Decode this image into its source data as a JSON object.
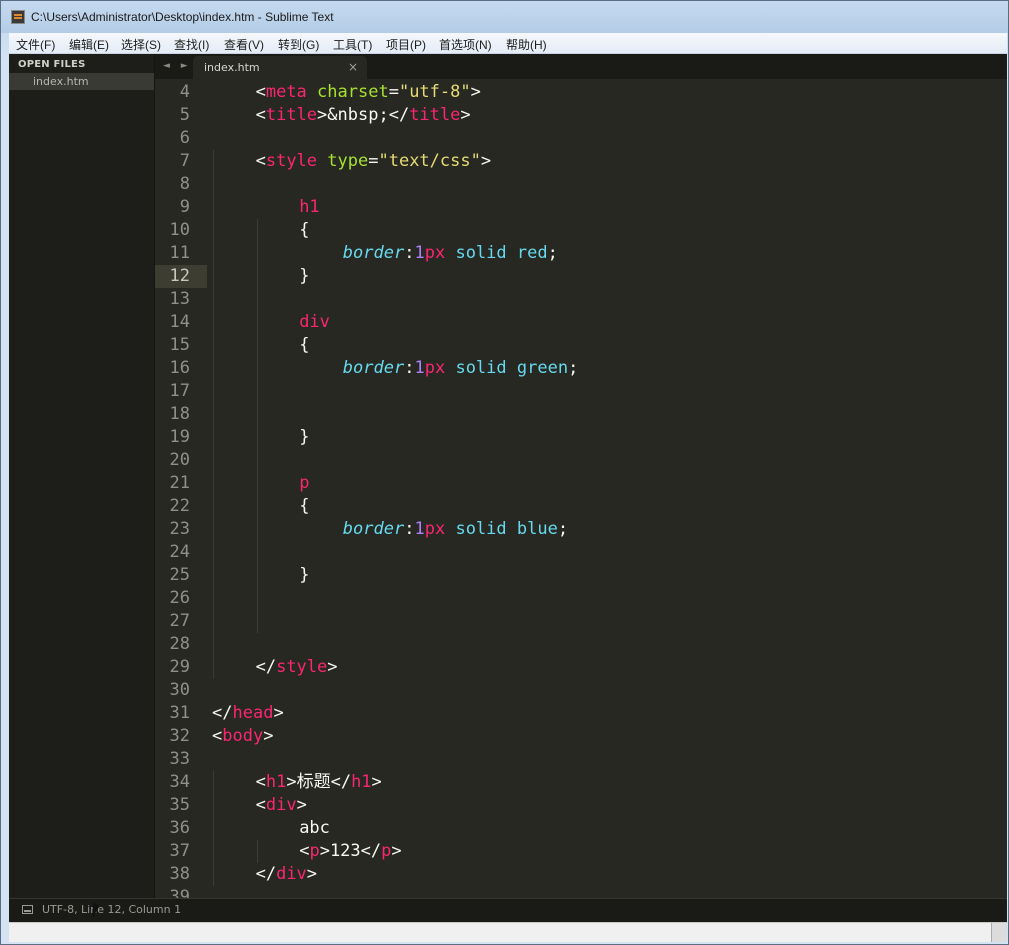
{
  "window": {
    "title": "C:\\Users\\Administrator\\Desktop\\index.htm - Sublime Text"
  },
  "menu": [
    "文件(F)",
    "编辑(E)",
    "选择(S)",
    "查找(I)",
    "查看(V)",
    "转到(G)",
    "工具(T)",
    "项目(P)",
    "首选项(N)",
    "帮助(H)"
  ],
  "sidebar": {
    "header": "OPEN FILES",
    "files": [
      "index.htm"
    ]
  },
  "tabs": {
    "nav": "◄ ►",
    "active": {
      "label": "index.htm",
      "close": "×"
    }
  },
  "editor": {
    "current_line": 12,
    "lines": [
      {
        "n": "4",
        "indent": 1,
        "tokens": [
          [
            "plain",
            "<"
          ],
          [
            "tag",
            "meta"
          ],
          [
            "plain",
            " "
          ],
          [
            "attr",
            "charset"
          ],
          [
            "plain",
            "="
          ],
          [
            "str",
            "\"utf-8\""
          ],
          [
            "plain",
            ">"
          ]
        ]
      },
      {
        "n": "5",
        "indent": 1,
        "tokens": [
          [
            "plain",
            "<"
          ],
          [
            "tag",
            "title"
          ],
          [
            "plain",
            ">"
          ],
          [
            "plain",
            "&nbsp;"
          ],
          [
            "plain",
            "</"
          ],
          [
            "tag",
            "title"
          ],
          [
            "plain",
            ">"
          ]
        ]
      },
      {
        "n": "6",
        "indent": 0,
        "tokens": []
      },
      {
        "n": "7",
        "indent": 1,
        "tokens": [
          [
            "plain",
            "<"
          ],
          [
            "tag",
            "style"
          ],
          [
            "plain",
            " "
          ],
          [
            "attr",
            "type"
          ],
          [
            "plain",
            "="
          ],
          [
            "str",
            "\"text/css\""
          ],
          [
            "plain",
            ">"
          ]
        ]
      },
      {
        "n": "8",
        "indent": 0,
        "tokens": []
      },
      {
        "n": "9",
        "indent": 2,
        "tokens": [
          [
            "tag",
            "h1"
          ]
        ]
      },
      {
        "n": "10",
        "indent": 2,
        "tokens": [
          [
            "plain",
            "{"
          ]
        ]
      },
      {
        "n": "11",
        "indent": 3,
        "tokens": [
          [
            "prop",
            "border"
          ],
          [
            "plain",
            ":"
          ],
          [
            "num",
            "1"
          ],
          [
            "unit",
            "px"
          ],
          [
            "plain",
            " "
          ],
          [
            "val",
            "solid"
          ],
          [
            "plain",
            " "
          ],
          [
            "val",
            "red"
          ],
          [
            "plain",
            ";"
          ]
        ]
      },
      {
        "n": "12",
        "indent": 2,
        "tokens": [
          [
            "plain",
            "}"
          ]
        ]
      },
      {
        "n": "13",
        "indent": 0,
        "tokens": []
      },
      {
        "n": "14",
        "indent": 2,
        "tokens": [
          [
            "tag",
            "div"
          ]
        ]
      },
      {
        "n": "15",
        "indent": 2,
        "tokens": [
          [
            "plain",
            "{"
          ]
        ]
      },
      {
        "n": "16",
        "indent": 3,
        "tokens": [
          [
            "prop",
            "border"
          ],
          [
            "plain",
            ":"
          ],
          [
            "num",
            "1"
          ],
          [
            "unit",
            "px"
          ],
          [
            "plain",
            " "
          ],
          [
            "val",
            "solid"
          ],
          [
            "plain",
            " "
          ],
          [
            "val",
            "green"
          ],
          [
            "plain",
            ";"
          ]
        ]
      },
      {
        "n": "17",
        "indent": 0,
        "tokens": []
      },
      {
        "n": "18",
        "indent": 0,
        "tokens": []
      },
      {
        "n": "19",
        "indent": 2,
        "tokens": [
          [
            "plain",
            "}"
          ]
        ]
      },
      {
        "n": "20",
        "indent": 0,
        "tokens": []
      },
      {
        "n": "21",
        "indent": 2,
        "tokens": [
          [
            "tag",
            "p"
          ]
        ]
      },
      {
        "n": "22",
        "indent": 2,
        "tokens": [
          [
            "plain",
            "{"
          ]
        ]
      },
      {
        "n": "23",
        "indent": 3,
        "tokens": [
          [
            "prop",
            "border"
          ],
          [
            "plain",
            ":"
          ],
          [
            "num",
            "1"
          ],
          [
            "unit",
            "px"
          ],
          [
            "plain",
            " "
          ],
          [
            "val",
            "solid"
          ],
          [
            "plain",
            " "
          ],
          [
            "val",
            "blue"
          ],
          [
            "plain",
            ";"
          ]
        ]
      },
      {
        "n": "24",
        "indent": 0,
        "tokens": []
      },
      {
        "n": "25",
        "indent": 2,
        "tokens": [
          [
            "plain",
            "}"
          ]
        ]
      },
      {
        "n": "26",
        "indent": 0,
        "tokens": []
      },
      {
        "n": "27",
        "indent": 0,
        "tokens": []
      },
      {
        "n": "28",
        "indent": 0,
        "tokens": []
      },
      {
        "n": "29",
        "indent": 1,
        "tokens": [
          [
            "plain",
            "</"
          ],
          [
            "tag",
            "style"
          ],
          [
            "plain",
            ">"
          ]
        ]
      },
      {
        "n": "30",
        "indent": 0,
        "tokens": []
      },
      {
        "n": "31",
        "indent": 0,
        "tokens": [
          [
            "plain",
            "</"
          ],
          [
            "tag",
            "head"
          ],
          [
            "plain",
            ">"
          ]
        ]
      },
      {
        "n": "32",
        "indent": 0,
        "tokens": [
          [
            "plain",
            "<"
          ],
          [
            "tag",
            "body"
          ],
          [
            "plain",
            ">"
          ]
        ]
      },
      {
        "n": "33",
        "indent": 0,
        "tokens": []
      },
      {
        "n": "34",
        "indent": 1,
        "tokens": [
          [
            "plain",
            "<"
          ],
          [
            "tag",
            "h1"
          ],
          [
            "plain",
            ">"
          ],
          [
            "plain",
            "标题"
          ],
          [
            "plain",
            "</"
          ],
          [
            "tag",
            "h1"
          ],
          [
            "plain",
            ">"
          ]
        ]
      },
      {
        "n": "35",
        "indent": 1,
        "tokens": [
          [
            "plain",
            "<"
          ],
          [
            "tag",
            "div"
          ],
          [
            "plain",
            ">"
          ]
        ]
      },
      {
        "n": "36",
        "indent": 2,
        "tokens": [
          [
            "plain",
            "abc"
          ]
        ]
      },
      {
        "n": "37",
        "indent": 2,
        "tokens": [
          [
            "plain",
            "<"
          ],
          [
            "tag",
            "p"
          ],
          [
            "plain",
            ">"
          ],
          [
            "plain",
            "123"
          ],
          [
            "plain",
            "</"
          ],
          [
            "tag",
            "p"
          ],
          [
            "plain",
            ">"
          ]
        ]
      },
      {
        "n": "38",
        "indent": 1,
        "tokens": [
          [
            "plain",
            "</"
          ],
          [
            "tag",
            "div"
          ],
          [
            "plain",
            ">"
          ]
        ]
      },
      {
        "n": "39",
        "indent": 0,
        "tokens": []
      }
    ]
  },
  "status": {
    "text": "UTF-8, Line 12, Column 1"
  },
  "colors": {
    "background": "#272822",
    "tag": "#f92672",
    "attribute": "#a6e22e",
    "string": "#e6db74",
    "property": "#66d9ef",
    "number": "#ae81ff"
  }
}
